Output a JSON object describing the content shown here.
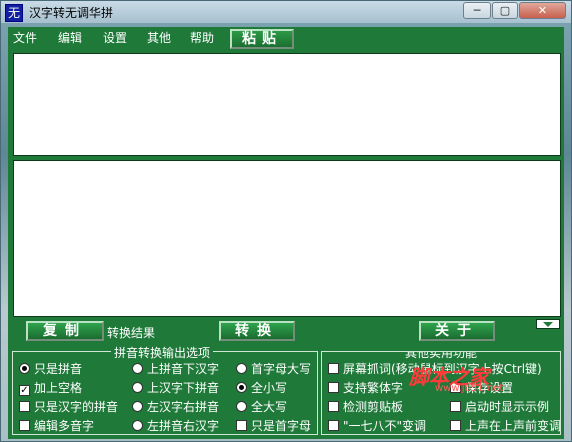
{
  "window": {
    "title": "汉字转无调华拼",
    "icon_char": "无",
    "minimize": "─",
    "maximize": "▢",
    "close": "✕"
  },
  "menu": [
    "文件",
    "编辑",
    "设置",
    "其他",
    "帮助"
  ],
  "paste_label": "粘贴",
  "input_text": "",
  "output_text": "",
  "buttons": {
    "copy": "复制",
    "convert": "转换",
    "about": "关于"
  },
  "result_label": "转换结果",
  "pinyin_group": {
    "title": "拼音转换输出选项",
    "col1": [
      {
        "type": "radio",
        "label": "只是拼音",
        "checked": true
      },
      {
        "type": "check",
        "label": "加上空格",
        "checked": true
      },
      {
        "type": "check",
        "label": "只是汉字的拼音",
        "checked": false
      },
      {
        "type": "check",
        "label": "编辑多音字",
        "checked": false
      }
    ],
    "col2": [
      {
        "type": "radio",
        "label": "上拼音下汉字",
        "checked": false
      },
      {
        "type": "radio",
        "label": "上汉字下拼音",
        "checked": false
      },
      {
        "type": "radio",
        "label": "左汉字右拼音",
        "checked": false
      },
      {
        "type": "radio",
        "label": "左拼音右汉字",
        "checked": false
      }
    ],
    "col3": [
      {
        "type": "radio",
        "label": "首字母大写",
        "checked": false
      },
      {
        "type": "radio",
        "label": "全小写",
        "checked": true
      },
      {
        "type": "radio",
        "label": "全大写",
        "checked": false
      },
      {
        "type": "check",
        "label": "只是首字母",
        "checked": false
      }
    ]
  },
  "other_group": {
    "title": "其他实用功能",
    "col1": [
      {
        "type": "check",
        "label": "屏幕抓词(移动鼠标到汉字上按Ctrl键)",
        "checked": false
      },
      {
        "type": "check",
        "label": "支持繁体字",
        "checked": false
      },
      {
        "type": "check",
        "label": "检测剪贴板",
        "checked": false
      },
      {
        "type": "check",
        "label": "\"一七八不\"变调",
        "checked": false
      }
    ],
    "col2": [
      {
        "type": "check",
        "label": "",
        "checked": false
      },
      {
        "type": "check",
        "label": "保存设置",
        "checked": false
      },
      {
        "type": "check",
        "label": "启动时显示示例",
        "checked": false
      },
      {
        "type": "check",
        "label": "上声在上声前变调",
        "checked": false
      }
    ]
  },
  "watermark": {
    "text": "脚本之家",
    "sub": "www.jb51.net"
  }
}
